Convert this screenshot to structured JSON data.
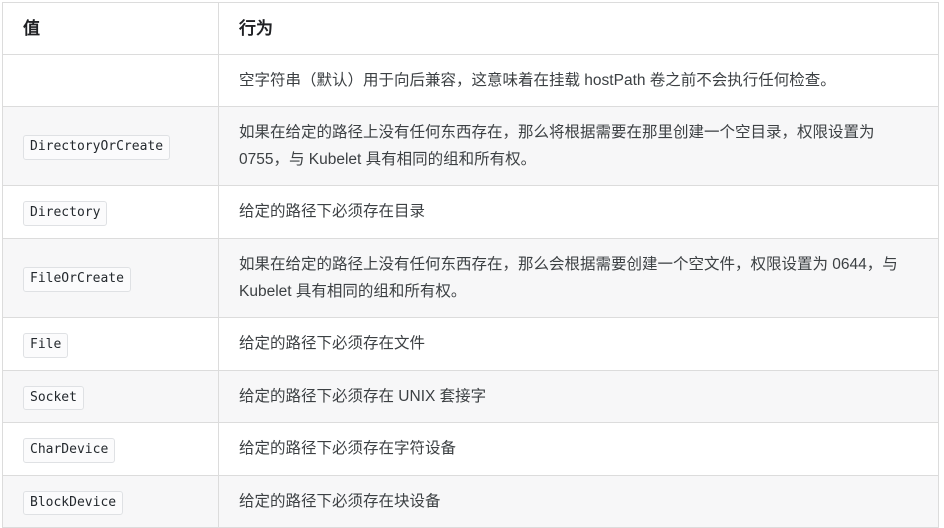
{
  "table": {
    "columns": [
      {
        "key": "value",
        "header": "值"
      },
      {
        "key": "behavior",
        "header": "行为"
      }
    ],
    "rows": [
      {
        "value": "",
        "behavior": "空字符串（默认）用于向后兼容，这意味着在挂载 hostPath 卷之前不会执行任何检查。",
        "striped": false
      },
      {
        "value": "DirectoryOrCreate",
        "behavior": "如果在给定的路径上没有任何东西存在，那么将根据需要在那里创建一个空目录，权限设置为 0755，与 Kubelet 具有相同的组和所有权。",
        "striped": true
      },
      {
        "value": "Directory",
        "behavior": "给定的路径下必须存在目录",
        "striped": false
      },
      {
        "value": "FileOrCreate",
        "behavior": "如果在给定的路径上没有任何东西存在，那么会根据需要创建一个空文件，权限设置为 0644，与 Kubelet 具有相同的组和所有权。",
        "striped": true
      },
      {
        "value": "File",
        "behavior": "给定的路径下必须存在文件",
        "striped": false
      },
      {
        "value": "Socket",
        "behavior": "给定的路径下必须存在 UNIX 套接字",
        "striped": true
      },
      {
        "value": "CharDevice",
        "behavior": "给定的路径下必须存在字符设备",
        "striped": false
      },
      {
        "value": "BlockDevice",
        "behavior": "给定的路径下必须存在块设备",
        "striped": true
      }
    ]
  },
  "colors": {
    "border": "#dcdcdc",
    "row_stripe": "#f7f7f8",
    "row_plain": "#ffffff",
    "text": "#3c4043",
    "header_text": "#202124",
    "chip_bg": "#fbfbfc",
    "chip_border": "#dfe1e4",
    "chip_text": "#24292e"
  }
}
